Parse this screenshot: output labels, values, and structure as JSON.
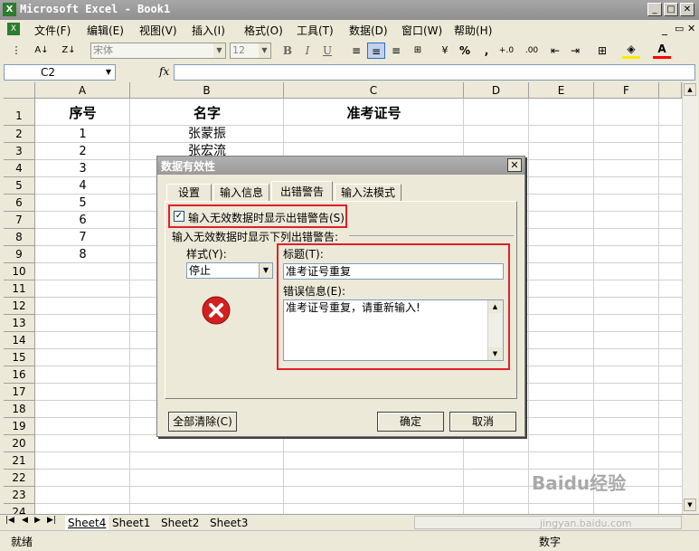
{
  "window": {
    "title": "Microsoft Excel - Book1",
    "icon": "excel-app-icon"
  },
  "menus": [
    "文件(F)",
    "编辑(E)",
    "视图(V)",
    "插入(I)",
    "格式(O)",
    "工具(T)",
    "数据(D)",
    "窗口(W)",
    "帮助(H)"
  ],
  "toolbar": {
    "font_name": "宋体",
    "font_size": "12",
    "bold": "B",
    "italic": "I",
    "underline": "U",
    "percent": "%",
    "comma": ",",
    "inc_decimal": "+.0",
    "dec_decimal": ".00"
  },
  "formula_bar": {
    "cell_ref": "C2",
    "fx": "fx",
    "formula": ""
  },
  "sheet": {
    "columns": [
      "A",
      "B",
      "C",
      "D",
      "E",
      "F"
    ],
    "rows": [
      "1",
      "2",
      "3",
      "4",
      "5",
      "6",
      "7",
      "8",
      "9",
      "10",
      "11",
      "12",
      "13",
      "14",
      "15",
      "16",
      "17",
      "18",
      "19",
      "20",
      "21",
      "22",
      "23",
      "24"
    ],
    "headers": {
      "A1": "序号",
      "B1": "名字",
      "C1": "准考证号"
    },
    "col_a": [
      "1",
      "2",
      "3",
      "4",
      "5",
      "6",
      "7",
      "8"
    ],
    "col_b": [
      "张蒙振",
      "张宏流"
    ]
  },
  "tabs": [
    "Sheet4",
    "Sheet1",
    "Sheet2",
    "Sheet3"
  ],
  "status": {
    "left": "就绪",
    "right": "数字"
  },
  "dialog": {
    "title": "数据有效性",
    "tabs": [
      "设置",
      "输入信息",
      "出错警告",
      "输入法模式"
    ],
    "active_tab": "出错警告",
    "checkbox_label": "输入无效数据时显示出错警告(S)",
    "checkbox_checked": true,
    "group_label": "输入无效数据时显示下列出错警告:",
    "style_label": "样式(Y):",
    "style_value": "停止",
    "title_label": "标题(T):",
    "title_value": "准考证号重复",
    "message_label": "错误信息(E):",
    "message_value": "准考证号重复，请重新输入!",
    "clear_button": "全部清除(C)",
    "ok_button": "确定",
    "cancel_button": "取消"
  },
  "watermark": {
    "text": "Baidu经验",
    "url_text": "jingyan.baidu.com"
  },
  "colors": {
    "highlight": "#e0202a",
    "error_icon": "#d42020"
  }
}
